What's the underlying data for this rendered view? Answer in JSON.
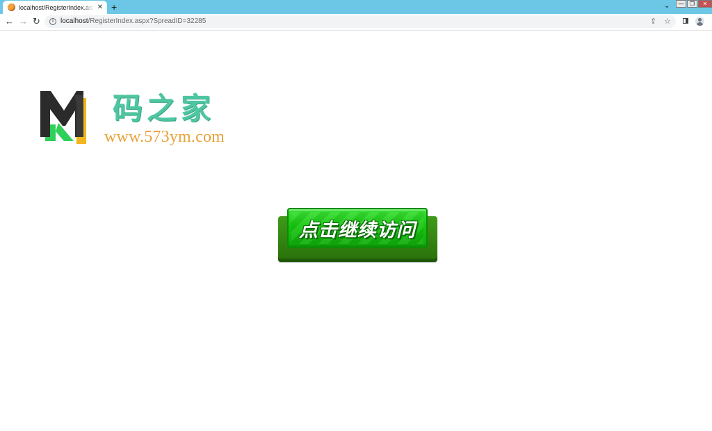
{
  "browser": {
    "tab": {
      "title": "localhost/RegisterIndex.aspx?",
      "close": "✕"
    },
    "new_tab": "+",
    "tab_search": "⌄",
    "window": {
      "minimize": "—",
      "restore": "❐",
      "close": "✕"
    },
    "nav": {
      "back": "←",
      "forward": "→",
      "reload": "↻"
    },
    "address": {
      "host": "localhost",
      "path": "/RegisterIndex.aspx?SpreadID=32285"
    },
    "icons": {
      "share": "share-icon",
      "star": "star-icon",
      "side_panel": "side-panel-icon",
      "profile": "profile-icon"
    },
    "share_glyph": "⇪",
    "star_glyph": "☆"
  },
  "page": {
    "logo": {
      "letter": "M",
      "name_cn": "码之家",
      "site": "www.573ym.com",
      "colors": {
        "dark": "#2b2b2b",
        "green": "#2fd05a",
        "yellow": "#f2b51c",
        "teal": "#4fc6a2",
        "orange": "#e8a23a"
      }
    },
    "continue_button": {
      "label": "点击继续访问",
      "colors": {
        "face": "#17c50f",
        "base": "#2f7d0e"
      }
    }
  }
}
